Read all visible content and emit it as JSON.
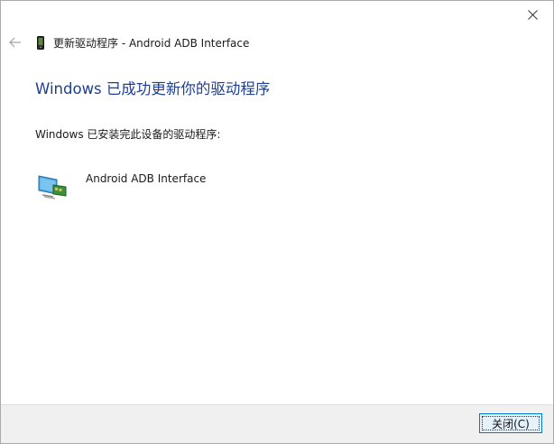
{
  "window": {
    "title": "更新驱动程序 - Android ADB Interface"
  },
  "content": {
    "heading": "Windows 已成功更新你的驱动程序",
    "description": "Windows 已安装完此设备的驱动程序:",
    "driver_name": "Android ADB Interface"
  },
  "footer": {
    "close_label": "关闭(C)"
  },
  "icons": {
    "close": "close-icon",
    "back": "back-arrow-icon",
    "device": "phone-device-icon",
    "driver": "network-adapter-icon"
  },
  "colors": {
    "heading": "#1c3f94",
    "button_border": "#0078d7",
    "button_fill": "#e5f1fb",
    "footer_bg": "#f0f0f0"
  }
}
